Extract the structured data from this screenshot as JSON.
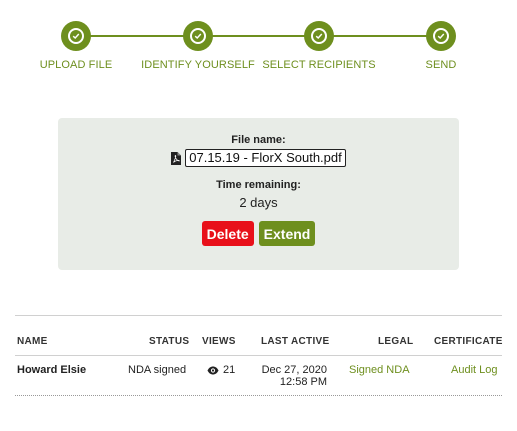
{
  "colors": {
    "accent": "#6e8f1e",
    "danger": "#e8101a",
    "card_bg": "#e8ece7",
    "text": "#222222"
  },
  "stepper": {
    "steps": [
      {
        "label": "UPLOAD FILE",
        "state": "complete",
        "icon": "check-icon"
      },
      {
        "label": "IDENTIFY YOURSELF",
        "state": "complete",
        "icon": "check-icon"
      },
      {
        "label": "SELECT RECIPIENTS",
        "state": "complete",
        "icon": "check-icon"
      },
      {
        "label": "SEND",
        "state": "complete",
        "icon": "check-icon"
      }
    ]
  },
  "file_card": {
    "file_label": "File name:",
    "file_icon": "pdf-file-icon",
    "file_name": "07.15.19 - FlorX South.pdf",
    "time_label": "Time remaining:",
    "time_value": "2 days",
    "delete_label": "Delete",
    "extend_label": "Extend"
  },
  "recipients_table": {
    "columns": [
      "NAME",
      "STATUS",
      "VIEWS",
      "LAST ACTIVE",
      "LEGAL",
      "CERTIFICATE"
    ],
    "rows": [
      {
        "name": "Howard Elsie",
        "status": "NDA signed",
        "views_icon": "eye-icon",
        "views": "21",
        "last_active_date": "Dec 27, 2020",
        "last_active_time": "12:58 PM",
        "legal": "Signed NDA",
        "certificate": "Audit Log"
      }
    ]
  }
}
